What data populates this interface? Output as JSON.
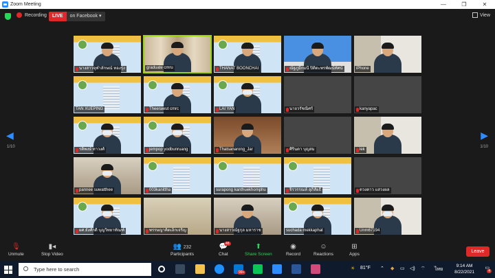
{
  "window": {
    "title": "Zoom Meeting",
    "controls": [
      "—",
      "❐",
      "✕"
    ]
  },
  "topbar": {
    "recording_label": "Recording",
    "live_label": "LIVE",
    "live_target": "on Facebook ▾",
    "view_label": "View"
  },
  "navigation": {
    "left_page": "1/10",
    "right_page": "1/10"
  },
  "tiles": [
    {
      "name": "นางสาวจุฬาลักษณ์  ทองรุ่ง",
      "bg": "banner",
      "muted": true,
      "person": true,
      "mask": false
    },
    {
      "name": "graduate cmru",
      "bg": "curtain",
      "muted": false,
      "person": true,
      "mask": false,
      "active": true
    },
    {
      "name": "THANAT BOONCHAI",
      "bg": "banner",
      "muted": true,
      "person": true,
      "mask": false
    },
    {
      "name": "ณัฐภูมิ์กมนี ปิติตะพรพัฒน์ทัศน์",
      "bg": "photo",
      "muted": true,
      "person": true,
      "mask": false
    },
    {
      "name": "iPhone",
      "bg": "office",
      "muted": false,
      "person": true,
      "mask": false
    },
    {
      "name": "TAN XUEPING",
      "bg": "banner",
      "muted": false,
      "person": false,
      "mask": false
    },
    {
      "name": "Theerawut cmrc",
      "bg": "banner",
      "muted": true,
      "person": true,
      "mask": false
    },
    {
      "name": "LAI YAN",
      "bg": "banner",
      "muted": true,
      "person": true,
      "mask": true
    },
    {
      "name": "นายวรัชณิศร์",
      "bg": "gray",
      "muted": true,
      "person": false,
      "mask": false
    },
    {
      "name": "kanyapac",
      "bg": "gray",
      "muted": true,
      "person": false,
      "mask": false
    },
    {
      "name": "รติพงษ์  ทาวงศ์",
      "bg": "banner",
      "muted": true,
      "person": true,
      "mask": true
    },
    {
      "name": "jempop yodbunruang",
      "bg": "banner",
      "muted": true,
      "person": true,
      "mask": true
    },
    {
      "name": "Thatsanarong_Jar",
      "bg": "wood",
      "muted": true,
      "person": true,
      "mask": false
    },
    {
      "name": "ศิรินดา  บุญสม",
      "bg": "gray",
      "muted": true,
      "person": false,
      "mask": false
    },
    {
      "name": "lek",
      "bg": "office",
      "muted": true,
      "person": true,
      "mask": false
    },
    {
      "name": "pannee suwatthee",
      "bg": "room",
      "muted": true,
      "person": true,
      "mask": true
    },
    {
      "name": "003kanittha",
      "bg": "banner",
      "muted": true,
      "person": false,
      "mask": false
    },
    {
      "name": "surapong kanthuekhomphu",
      "bg": "banner",
      "muted": false,
      "person": false,
      "mask": false
    },
    {
      "name": "จิรวรรณห์ สุภิสัยธิ์",
      "bg": "banner",
      "muted": true,
      "person": false,
      "mask": false
    },
    {
      "name": "ดวงดาว แสวงผล",
      "bg": "gray",
      "muted": true,
      "person": false,
      "mask": false
    },
    {
      "name": "ผศ.ยังศักดิ์ บุญวิทยาทัณฑ์",
      "bg": "banner",
      "muted": true,
      "person": true,
      "mask": true
    },
    {
      "name": "พรรษญาคิดเล็กเจริญ",
      "bg": "classroom",
      "muted": true,
      "person": false,
      "mask": false
    },
    {
      "name": "นางสาวณัฐกุล มหาราช",
      "bg": "room",
      "muted": true,
      "person": true,
      "mask": false
    },
    {
      "name": "suchada mekkaphat",
      "bg": "banner",
      "muted": false,
      "person": true,
      "mask": true
    },
    {
      "name": "Unm67194",
      "bg": "office",
      "muted": true,
      "person": true,
      "mask": true
    }
  ],
  "toolbar": {
    "unmute": "Unmute",
    "stop_video": "Stop Video",
    "participants": "Participants",
    "participant_count": "232",
    "chat": "Chat",
    "chat_badge": "48",
    "share_screen": "Share Screen",
    "record": "Record",
    "reactions": "Reactions",
    "apps": "Apps",
    "leave": "Leave"
  },
  "taskbar": {
    "search_placeholder": "Type here to search",
    "weather": "81°F",
    "language": "ไทย",
    "time": "9:14 AM",
    "date": "8/22/2021",
    "notification_count": "4",
    "mail_badge": "99+"
  },
  "colors": {
    "accent_blue": "#2d8cff",
    "live_red": "#e02828",
    "share_green": "#23d959",
    "active_border": "#9ad40d"
  }
}
